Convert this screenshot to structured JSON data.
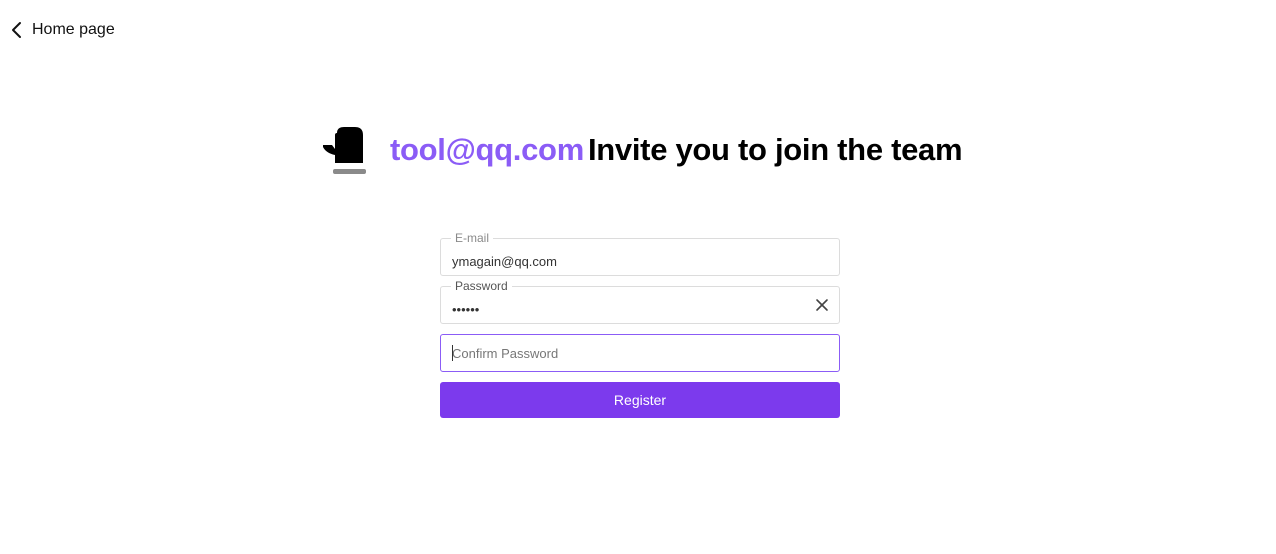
{
  "nav": {
    "back_label": "Home page",
    "back_icon": "chevron-left-icon"
  },
  "hero": {
    "logo_icon": "mitten-icon",
    "inviter_email": "tool@qq.com",
    "invite_text": "Invite you to join the team",
    "accent_color": "#8b5cf6"
  },
  "form": {
    "email": {
      "label": "E-mail",
      "value": "ymagain@qq.com"
    },
    "password": {
      "label": "Password",
      "value": "••••••",
      "clear_icon": "close-icon"
    },
    "confirm_password": {
      "placeholder": "Confirm Password",
      "value": ""
    },
    "register_label": "Register",
    "button_color": "#7c3aed"
  }
}
